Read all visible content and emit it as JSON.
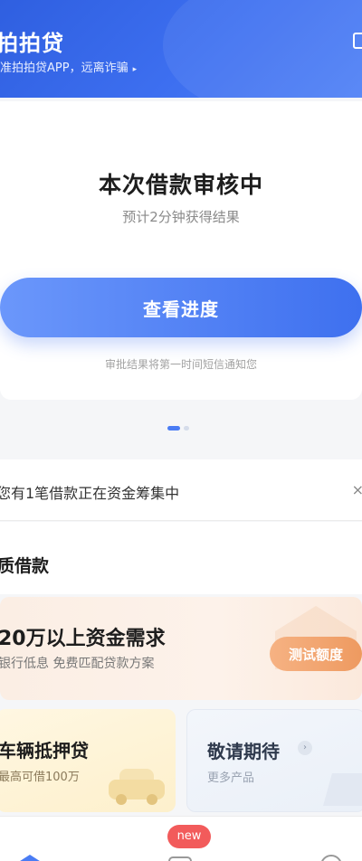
{
  "header": {
    "logo": "拍拍贷",
    "slogan": "准拍拍贷APP，远离诈骗",
    "slogan_arrow": "▸"
  },
  "status": {
    "title": "本次借款审核中",
    "subtitle": "预计2分钟获得结果",
    "button_label": "查看进度",
    "notice": "审批结果将第一时间短信通知您"
  },
  "fund_notice": {
    "text": "您有1笔借款正在资金筹集中",
    "close": "×"
  },
  "section": {
    "title": "质借款"
  },
  "promo": {
    "title": "20万以上资金需求",
    "subtitle": "银行低息 免费匹配贷款方案",
    "button_label": "测试额度"
  },
  "products": [
    {
      "title": "车辆抵押贷",
      "subtitle": "最高可借100万"
    },
    {
      "title": "敬请期待",
      "subtitle": "更多产品",
      "chevron": "›"
    }
  ],
  "tabbar": {
    "badge": "new"
  },
  "colors": {
    "primary": "#3e70ef",
    "accent": "#ee9a60",
    "badge": "#f25b5b"
  }
}
